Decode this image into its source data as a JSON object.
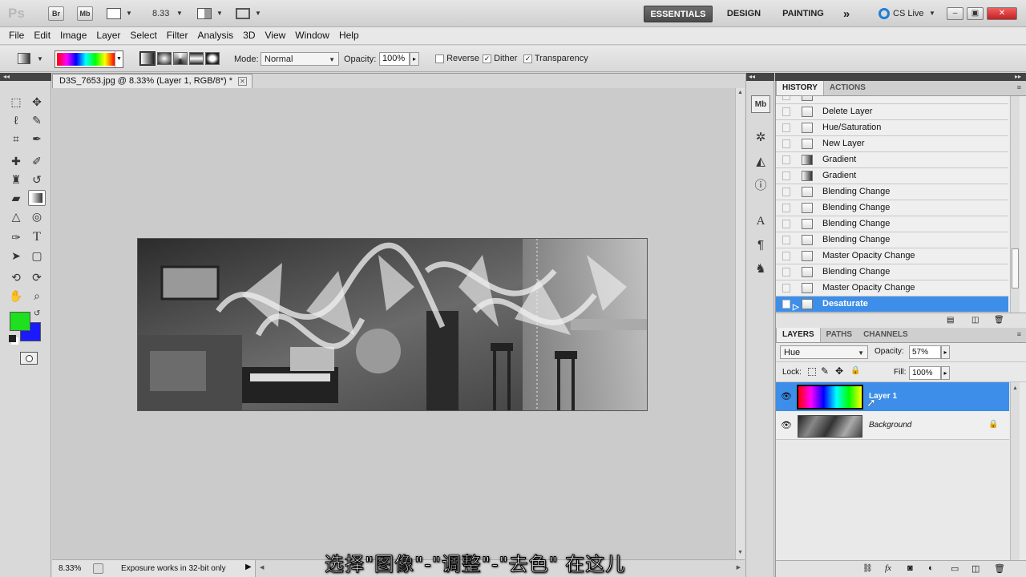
{
  "app": {
    "logo": "Ps",
    "bridge": "Br",
    "minibridge": "Mb",
    "zoom": "8.33",
    "workspaces": [
      "ESSENTIALS",
      "DESIGN",
      "PAINTING"
    ],
    "more": "»",
    "cslive": "CS Live"
  },
  "menu": [
    "File",
    "Edit",
    "Image",
    "Layer",
    "Select",
    "Filter",
    "Analysis",
    "3D",
    "View",
    "Window",
    "Help"
  ],
  "options": {
    "mode_label": "Mode:",
    "mode_value": "Normal",
    "opacity_label": "Opacity:",
    "opacity_value": "100%",
    "reverse": "Reverse",
    "dither": "Dither",
    "transparency": "Transparency"
  },
  "document": {
    "tab_title": "D3S_7653.jpg @ 8.33% (Layer 1, RGB/8*) *",
    "status_zoom": "8.33%",
    "status_info": "Exposure works in 32-bit only"
  },
  "colors": {
    "foreground": "#1ee01e",
    "background": "#1a1aff",
    "selection": "#3d8ee8"
  },
  "history": {
    "tabs": [
      "HISTORY",
      "ACTIONS"
    ],
    "items": [
      "Delete Layer",
      "Hue/Saturation",
      "New Layer",
      "Gradient",
      "Gradient",
      "Blending Change",
      "Blending Change",
      "Blending Change",
      "Blending Change",
      "Master Opacity Change",
      "Blending Change",
      "Master Opacity Change",
      "Desaturate"
    ]
  },
  "layers": {
    "tabs": [
      "LAYERS",
      "PATHS",
      "CHANNELS"
    ],
    "blend": "Hue",
    "opacity_label": "Opacity:",
    "opacity_value": "57%",
    "lock_label": "Lock:",
    "fill_label": "Fill:",
    "fill_value": "100%",
    "items": [
      {
        "name": "Layer 1"
      },
      {
        "name": "Background"
      }
    ]
  },
  "subtitle": "选择\"图像\"-\"调整\"-\"去色\" 在这儿"
}
